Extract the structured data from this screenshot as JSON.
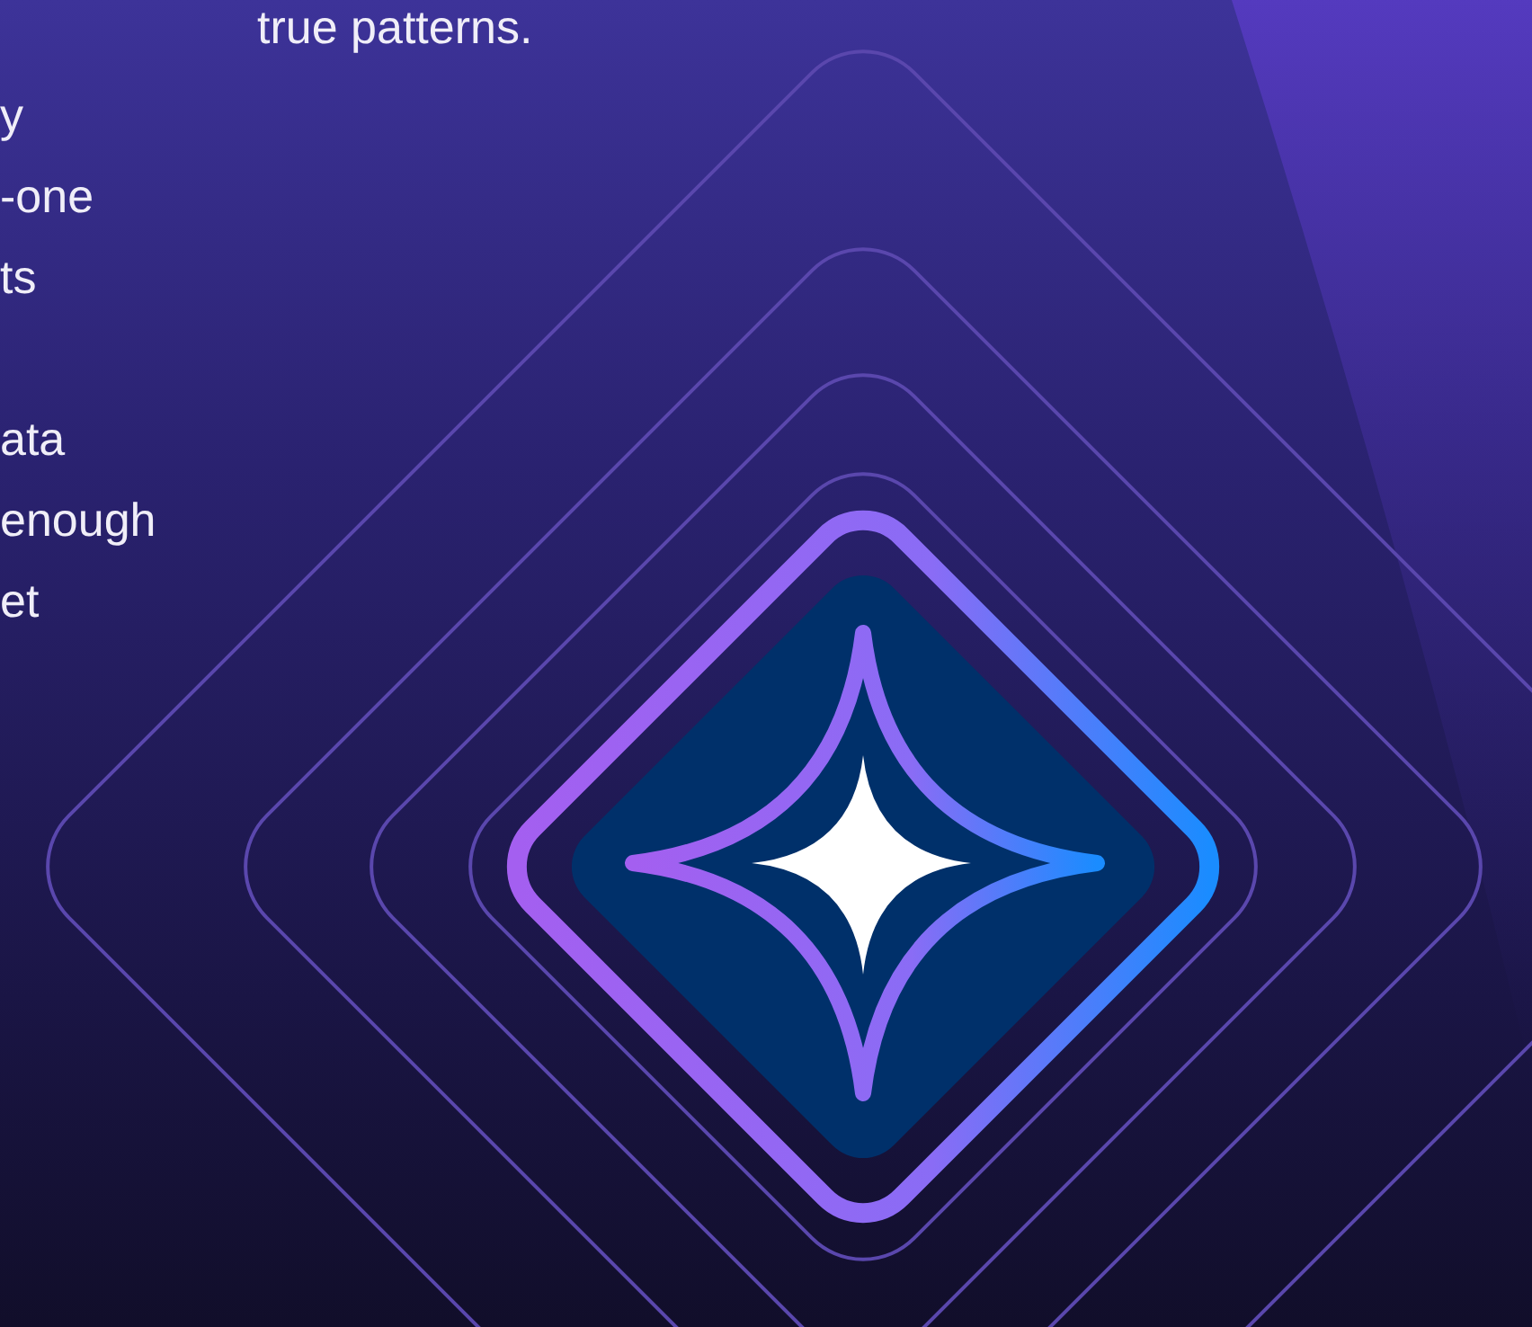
{
  "intro_text": "true patterns.",
  "paragraphs": [
    {
      "lines": [
        "y",
        "-one",
        "ts"
      ]
    },
    {
      "lines": [
        "ata",
        "enough",
        "et"
      ]
    }
  ]
}
